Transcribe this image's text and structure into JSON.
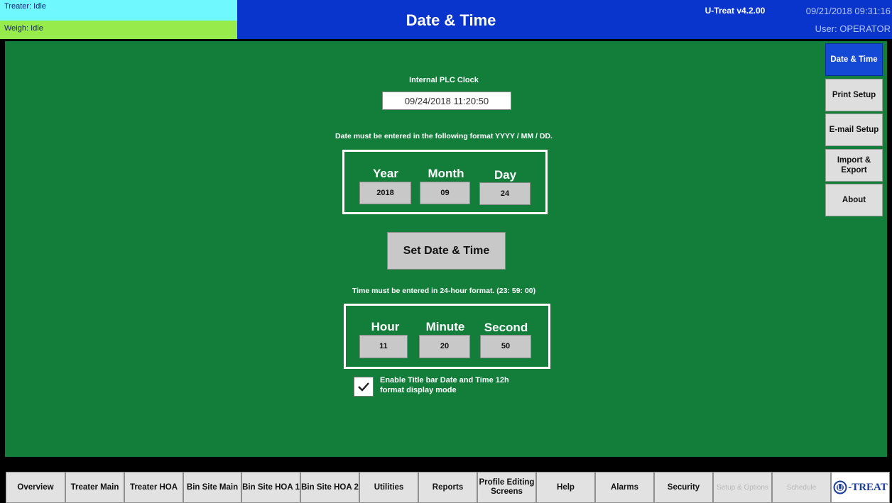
{
  "header": {
    "treater_status": "Treater: Idle",
    "weigh_status": "Weigh: Idle",
    "title": "Date & Time",
    "version": "U-Treat v4.2.00",
    "datetime": "09/21/2018 09:31:16",
    "user": "User: OPERATOR"
  },
  "clock": {
    "caption": "Internal PLC Clock",
    "value": "09/24/2018 11:20:50"
  },
  "date": {
    "instructions": "Date must be entered in the following format YYYY / MM / DD.",
    "year_label": "Year",
    "month_label": "Month",
    "day_label": "Day",
    "year_value": "2018",
    "month_value": "09",
    "day_value": "24"
  },
  "set_button_label": "Set Date & Time",
  "time": {
    "instructions": "Time must be entered in 24-hour format. (23: 59: 00)",
    "hour_label": "Hour",
    "minute_label": "Minute",
    "second_label": "Second",
    "hour_value": "11",
    "minute_value": "20",
    "second_value": "50"
  },
  "title_bar_format": {
    "checked": true,
    "label_line1": "Enable Title bar Date and Time 12h",
    "label_line2": "format display mode"
  },
  "side_nav": [
    {
      "label": "Date & Time",
      "active": true
    },
    {
      "label": "Print Setup",
      "active": false
    },
    {
      "label": "E-mail Setup",
      "active": false
    },
    {
      "label": "Import & Export",
      "active": false
    },
    {
      "label": "About",
      "active": false
    }
  ],
  "bottom_nav": [
    {
      "label": "Overview"
    },
    {
      "label": "Treater Main"
    },
    {
      "label": "Treater HOA"
    },
    {
      "label": "Bin Site Main"
    },
    {
      "label": "Bin Site HOA 1"
    },
    {
      "label": "Bin Site HOA 2"
    },
    {
      "label": "Utilities"
    },
    {
      "label": "Reports"
    },
    {
      "label": "Profile Editing Screens"
    },
    {
      "label": "Help"
    },
    {
      "label": "Alarms"
    },
    {
      "label": "Security"
    },
    {
      "label": "Setup & Options",
      "disabled": true
    },
    {
      "label": "Schedule",
      "disabled": true
    }
  ],
  "logo": {
    "text": "-TREAT",
    "icon": "u-treat-logo-icon"
  },
  "colors": {
    "main_background": "#127e3a",
    "header_blue": "#0a35cc",
    "treater_status": "#6ff9ff",
    "weigh_status": "#97ec4b",
    "active_nav": "#1449d6"
  }
}
